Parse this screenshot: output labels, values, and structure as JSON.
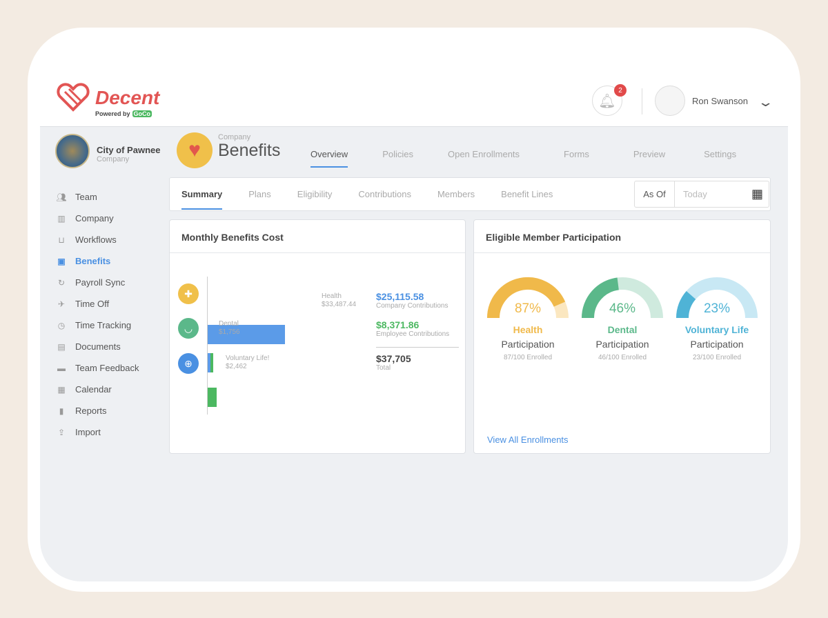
{
  "brand": {
    "name": "Decent",
    "powered_by": "Powered by",
    "partner": "GoCo"
  },
  "header": {
    "notifications": "2",
    "user_name": "Ron Swanson"
  },
  "org": {
    "name": "City of Pawnee",
    "type": "Company"
  },
  "sidebar": {
    "items": [
      {
        "label": "Team",
        "icon": "team-icon"
      },
      {
        "label": "Company",
        "icon": "building-icon"
      },
      {
        "label": "Workflows",
        "icon": "workflow-icon"
      },
      {
        "label": "Benefits",
        "icon": "benefits-icon",
        "active": true
      },
      {
        "label": "Payroll Sync",
        "icon": "sync-icon"
      },
      {
        "label": "Time Off",
        "icon": "plane-icon"
      },
      {
        "label": "Time Tracking",
        "icon": "clock-icon"
      },
      {
        "label": "Documents",
        "icon": "document-icon"
      },
      {
        "label": "Team Feedback",
        "icon": "feedback-icon"
      },
      {
        "label": "Calendar",
        "icon": "calendar-icon"
      },
      {
        "label": "Reports",
        "icon": "reports-icon"
      },
      {
        "label": "Import",
        "icon": "upload-icon"
      }
    ]
  },
  "page": {
    "subtitle": "Company",
    "title": "Benefits",
    "tabs": [
      "Overview",
      "Policies",
      "Open Enrollments",
      "Forms",
      "Preview",
      "Settings"
    ]
  },
  "subtabs": [
    "Summary",
    "Plans",
    "Eligibility",
    "Contributions",
    "Members",
    "Benefit Lines"
  ],
  "as_of": {
    "label": "As Of",
    "value": "Today"
  },
  "cost": {
    "title": "Monthly Benefits Cost",
    "lines": [
      {
        "name": "Health",
        "amount": "$33,487.44",
        "value": 33487.44
      },
      {
        "name": "Dental",
        "amount": "$1,756",
        "value": 1756
      },
      {
        "name": "Voluntary Life!",
        "amount": "$2,462",
        "value": 2462
      }
    ],
    "company": {
      "value": "$25,115.58",
      "label": "Company Contributions"
    },
    "employee": {
      "value": "$8,371.86",
      "label": "Employee Contributions"
    },
    "total": {
      "value": "$37,705",
      "label": "Total"
    }
  },
  "participation": {
    "title": "Eligible Member Participation",
    "link": "View All Enrollments",
    "gauges": [
      {
        "pct": "87%",
        "fraction": 0.87,
        "name": "Health",
        "label": "Participation",
        "enrolled": "87/100 Enrolled",
        "color": "#f0b94a",
        "light": "#fbe7c0"
      },
      {
        "pct": "46%",
        "fraction": 0.46,
        "name": "Dental",
        "label": "Participation",
        "enrolled": "46/100 Enrolled",
        "color": "#5bb88a",
        "light": "#cfeade"
      },
      {
        "pct": "23%",
        "fraction": 0.23,
        "name": "Voluntary Life",
        "label": "Participation",
        "enrolled": "23/100 Enrolled",
        "color": "#4fb3d6",
        "light": "#c8e8f4"
      }
    ]
  }
}
